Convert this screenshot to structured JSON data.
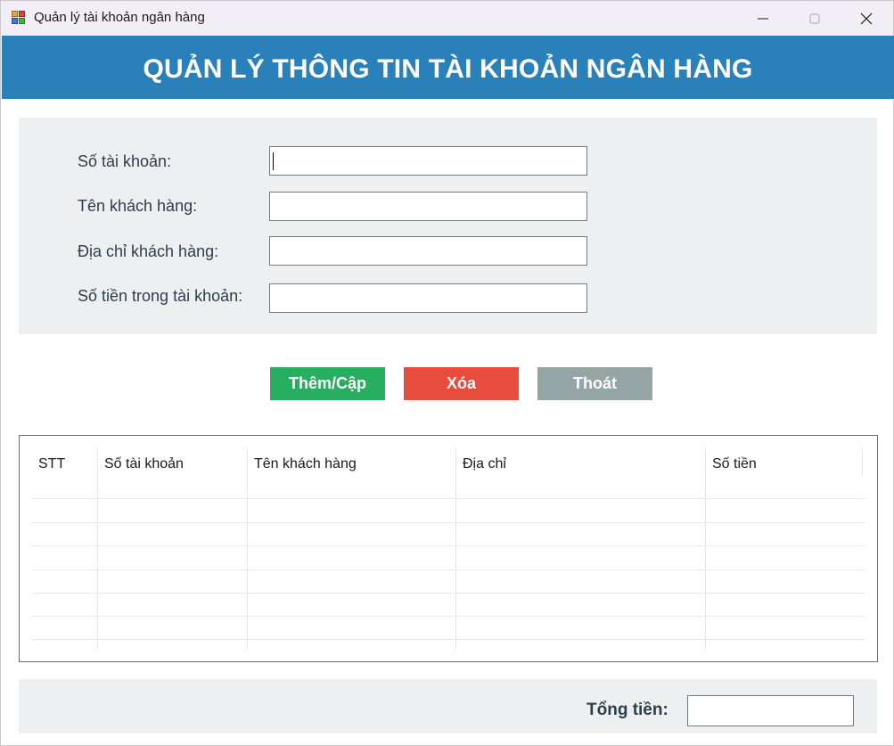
{
  "window": {
    "title": "Quản lý tài khoản ngân hàng",
    "icons": {
      "app": "app-icon",
      "minimize": "minimize-icon",
      "maximize": "maximize-icon",
      "close": "close-icon"
    }
  },
  "header": {
    "title": "QUẢN LÝ THÔNG TIN TÀI KHOẢN NGÂN HÀNG"
  },
  "form": {
    "account_number_label": "Số tài khoản:",
    "account_number_value": "",
    "customer_name_label": "Tên khách hàng:",
    "customer_name_value": "",
    "address_label": "Địa chỉ khách hàng:",
    "address_value": "",
    "balance_label": "Số tiền trong tài khoản:",
    "balance_value": ""
  },
  "buttons": {
    "add_update": "Thêm/Cập",
    "delete": "Xóa",
    "exit": "Thoát"
  },
  "table": {
    "columns": [
      "STT",
      "Số tài khoản",
      "Tên khách hàng",
      "Địa chỉ",
      "Số tiền"
    ],
    "rows": []
  },
  "footer": {
    "total_label": "Tổng tiền:",
    "total_value": ""
  },
  "colors": {
    "banner": "#2a80b9",
    "panel": "#ecf0f1",
    "add_button": "#27ae60",
    "delete_button": "#e74c3c",
    "exit_button": "#95a5a6"
  }
}
